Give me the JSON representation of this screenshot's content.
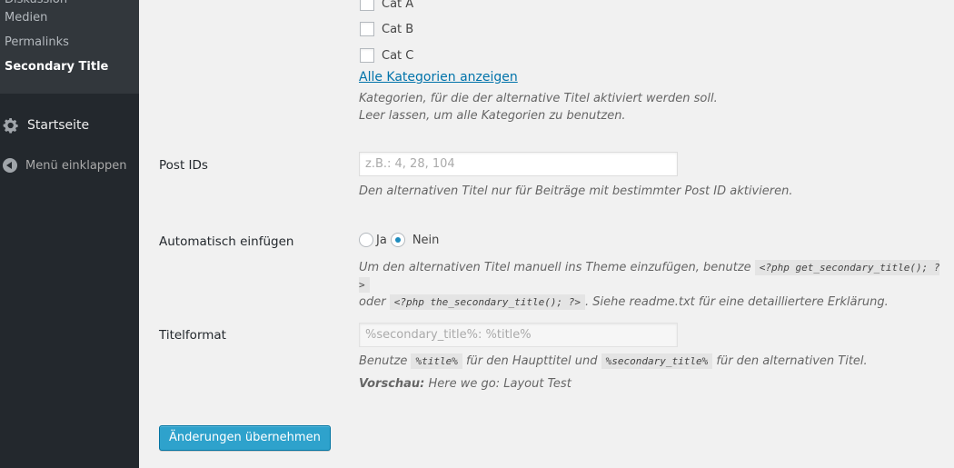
{
  "sidebar": {
    "submenu": [
      "Diskussion",
      "Medien",
      "Permalinks",
      "Secondary Title"
    ],
    "current": "Secondary Title",
    "menu_startseite": "Startseite",
    "menu_collapse": "Menü einklappen"
  },
  "categories": {
    "items": [
      "Cat A",
      "Cat B",
      "Cat C"
    ],
    "show_all_link": "Alle Kategorien anzeigen",
    "desc_line1": "Kategorien, für die der alternative Titel aktiviert werden soll.",
    "desc_line2": "Leer lassen, um alle Kategorien zu benutzen."
  },
  "post_ids": {
    "label": "Post IDs",
    "placeholder": "z.B.: 4, 28, 104",
    "desc": "Den alternativen Titel nur für Beiträge mit bestimmter Post ID aktivieren."
  },
  "auto_insert": {
    "label": "Automatisch einfügen",
    "option_yes": "Ja",
    "option_no": "Nein",
    "selected": "Nein",
    "desc_part1": "Um den alternativen Titel manuell ins Theme einzufügen, benutze",
    "code1": "<?php get_secondary_title(); ?>",
    "desc_part2": "oder",
    "code2": "<?php the_secondary_title(); ?>",
    "desc_part3": ". Siehe readme.txt für eine detailliertere Erklärung."
  },
  "title_format": {
    "label": "Titelformat",
    "value": "%secondary_title%: %title%",
    "desc_part1": "Benutze",
    "code1": "%title%",
    "desc_part2": "für den Haupttitel und",
    "code2": "%secondary_title%",
    "desc_part3": "für den alternativen Titel.",
    "preview_label": "Vorschau:",
    "preview_value": "Here we go: Layout Test"
  },
  "submit_label": "Änderungen übernehmen",
  "colors": {
    "sidebar_bg": "#23282d",
    "submenu_bg": "#32373c",
    "link": "#0073aa",
    "button_bg": "#2ea2cc"
  }
}
